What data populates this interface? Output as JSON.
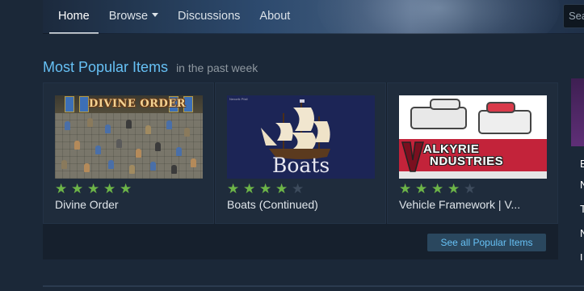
{
  "nav": {
    "items": [
      {
        "label": "Home",
        "active": true
      },
      {
        "label": "Browse",
        "dropdown": true
      },
      {
        "label": "Discussions"
      },
      {
        "label": "About"
      }
    ],
    "search_placeholder": "Search"
  },
  "section": {
    "title": "Most Popular Items",
    "subtitle": "in the past week"
  },
  "cards": [
    {
      "title": "Divine Order",
      "rating": 5,
      "thumbnail": {
        "logo_text": "DIVINE ORDER"
      }
    },
    {
      "title": "Boats (Continued)",
      "rating": 4,
      "thumbnail": {
        "word": "Boats",
        "tag": "Nexorik Pfall"
      }
    },
    {
      "title": "Vehicle Framework  |  V...",
      "rating": 4,
      "thumbnail": {
        "line1": "ALKYRIE",
        "line2": "NDUSTRIES"
      }
    }
  ],
  "see_all": "See all Popular Items",
  "side_panel": {
    "letters": [
      "E",
      "N",
      "T",
      "N",
      "L"
    ]
  },
  "colors": {
    "accent": "#66c0f4",
    "star_on": "#6db548",
    "star_off": "#3d4b5c",
    "background": "#1b2838"
  }
}
